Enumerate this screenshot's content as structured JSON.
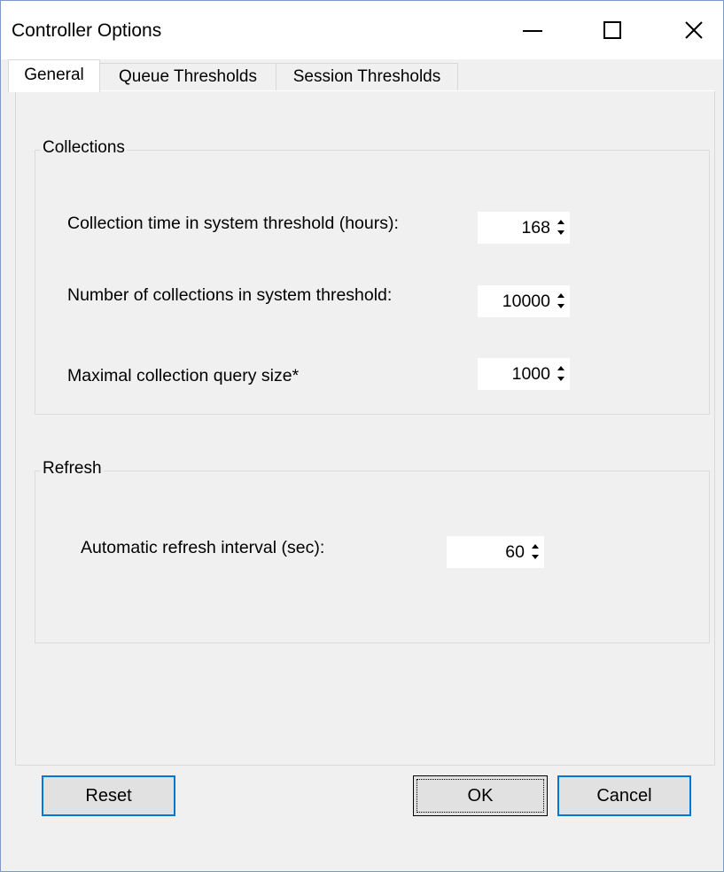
{
  "window": {
    "title": "Controller Options"
  },
  "tabs": [
    {
      "label": "General",
      "active": true
    },
    {
      "label": "Queue Thresholds",
      "active": false
    },
    {
      "label": "Session Thresholds",
      "active": false
    }
  ],
  "collections": {
    "legend": "Collections",
    "rows": [
      {
        "label": "Collection time in system threshold (hours):",
        "value": "168"
      },
      {
        "label": "Number of collections in system threshold:",
        "value": "10000"
      },
      {
        "label": "Maximal collection query size*",
        "value": "1000"
      }
    ]
  },
  "refresh": {
    "legend": "Refresh",
    "rows": [
      {
        "label": "Automatic refresh interval (sec):",
        "value": "60"
      }
    ]
  },
  "buttons": {
    "reset": "Reset",
    "ok": "OK",
    "cancel": "Cancel"
  },
  "icons": {
    "minimize": "minimize-icon",
    "maximize": "maximize-icon",
    "close": "close-icon",
    "spin_up": "spin-up-icon",
    "spin_down": "spin-down-icon"
  },
  "colors": {
    "window_bg": "#f0f0f0",
    "accent": "#0078d7",
    "titlebar": "#ffffff"
  }
}
